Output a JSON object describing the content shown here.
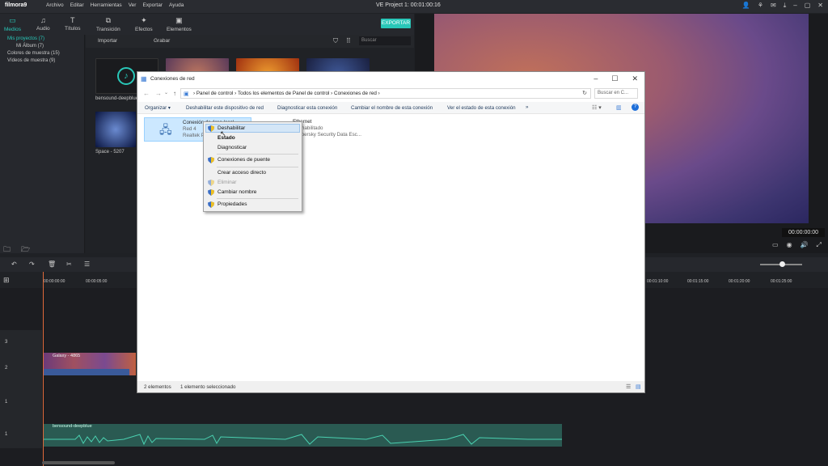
{
  "filmora": {
    "logo": "filmora9",
    "menu": [
      "Archivo",
      "Editar",
      "Herramientas",
      "Ver",
      "Exportar",
      "Ayuda"
    ],
    "project_title": "VE Project 1:  00:01:00:16",
    "tabs": [
      {
        "label": "Medios",
        "icon": "folder-icon"
      },
      {
        "label": "Audio",
        "icon": "music-note-icon"
      },
      {
        "label": "Títulos",
        "icon": "title-t-icon"
      },
      {
        "label": "Transición",
        "icon": "transition-icon"
      },
      {
        "label": "Efectos",
        "icon": "effects-icon"
      },
      {
        "label": "Elementos",
        "icon": "elements-icon"
      }
    ],
    "export_label": "EXPORTAR",
    "library": {
      "my_projects": "Mis proyectos (7)",
      "my_album": "Mi Álbum (7)",
      "sample_colors": "Colores de muestra (15)",
      "sample_videos": "Vídeos de muestra (9)"
    },
    "media_bar": {
      "import": "Importar",
      "record": "Grabar",
      "search_placeholder": "Buscar"
    },
    "media_items": [
      {
        "label": "bensound-deepblue"
      },
      {
        "label": "Space - 5207"
      }
    ],
    "preview_time": "00:00:00:00",
    "ruler_labels": [
      "00:00:00:00",
      "00:00:05:00",
      "00:01:10:00",
      "00:01:15:00",
      "00:01:20:00",
      "00:01:25:00"
    ],
    "clips": {
      "video": "Galaxy - 4865",
      "audio": "bensound-deepblue"
    },
    "tracks": [
      "3",
      "2",
      "1",
      "1"
    ],
    "accent_color": "#29c7b8"
  },
  "dialog": {
    "title": "Conexiones de red",
    "breadcrumb": [
      "Panel de control",
      "Todos los elementos de Panel de control",
      "Conexiones de red"
    ],
    "search_placeholder": "Buscar en C...",
    "commands": [
      "Organizar ▾",
      "Deshabilitar este dispositivo de red",
      "Diagnosticar esta conexión",
      "Cambiar el nombre de esta conexión",
      "Ver el estado de esta conexión",
      "»"
    ],
    "connections": [
      {
        "name": "Conexión de área local",
        "status": "Red  4",
        "device": "Realtek P"
      },
      {
        "name": "Ethernet",
        "status": "Deshabilitado",
        "device": "Kaspersky Security Data Esc..."
      }
    ],
    "status": {
      "count": "2 elementos",
      "selected": "1 elemento seleccionado"
    }
  },
  "context_menu": {
    "items": [
      {
        "label": "Deshabilitar",
        "shield": true
      },
      {
        "label": "Estado",
        "shield": false
      },
      {
        "label": "Diagnosticar",
        "shield": false
      },
      {
        "label": "Conexiones de puente",
        "shield": true
      },
      {
        "label": "Crear acceso directo",
        "shield": false
      },
      {
        "label": "Eliminar",
        "shield": true
      },
      {
        "label": "Cambiar nombre",
        "shield": true
      },
      {
        "label": "Propiedades",
        "shield": true
      }
    ]
  }
}
